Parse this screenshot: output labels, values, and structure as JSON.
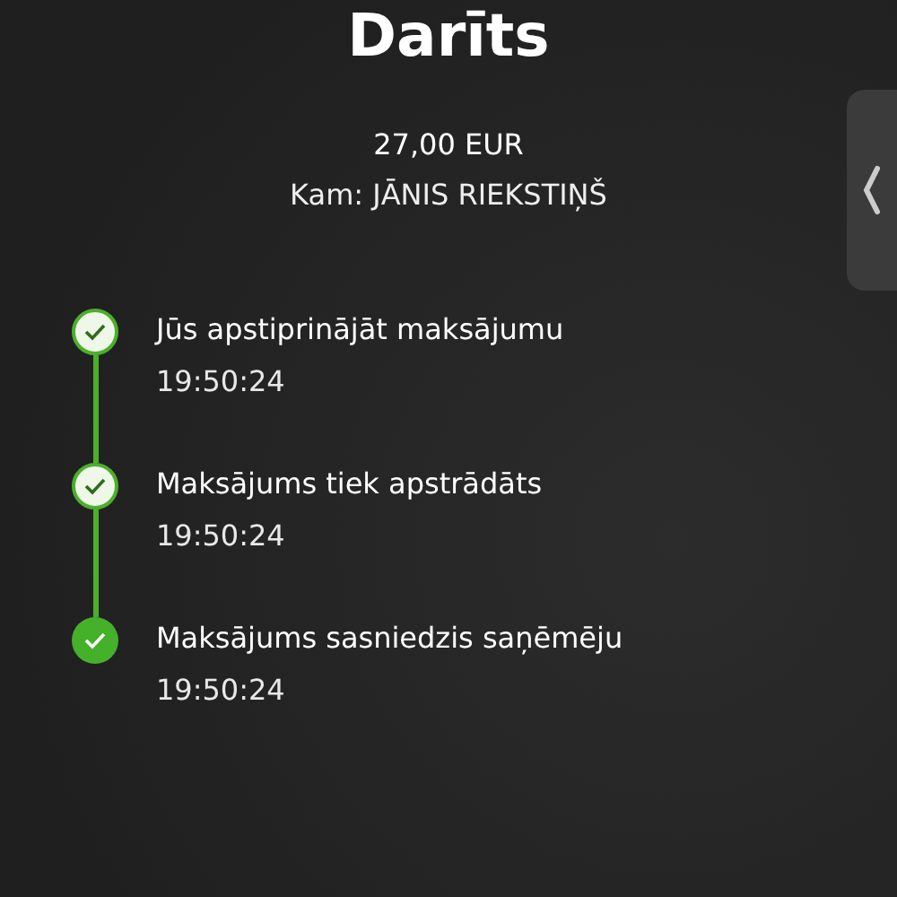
{
  "title": "Darīts",
  "amount": "27,00 EUR",
  "recipient": "Kam: JĀNIS RIEKSTIŅŠ",
  "steps": [
    {
      "label": "Jūs apstiprinājāt maksājumu",
      "time": "19:50:24",
      "kind": "done"
    },
    {
      "label": "Maksājums tiek apstrādāts",
      "time": "19:50:24",
      "kind": "done"
    },
    {
      "label": "Maksājums sasniedzis saņēmēju",
      "time": "19:50:24",
      "kind": "current"
    }
  ]
}
